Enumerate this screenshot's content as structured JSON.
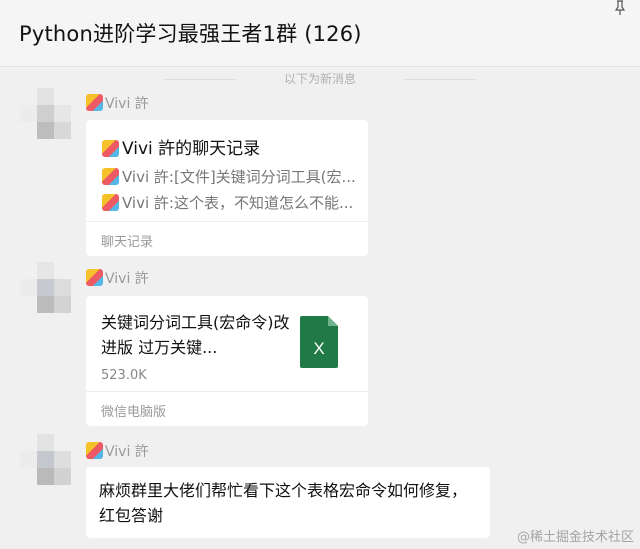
{
  "header": {
    "title": "Python进阶学习最强王者1群 (126)"
  },
  "divider": {
    "text": "以下为新消息"
  },
  "messages": [
    {
      "sender": "Vivi 許",
      "card": {
        "title": "Vivi 許的聊天记录",
        "lines": [
          "Vivi 許:[文件]关键词分词工具(宏...",
          "Vivi 許:这个表，不知道怎么不能..."
        ],
        "footer": "聊天记录"
      }
    },
    {
      "sender": "Vivi 許",
      "file": {
        "name": "关键词分词工具(宏命令)改进版 过万关键...",
        "size": "523.0K",
        "icon_letter": "X",
        "footer": "微信电脑版"
      }
    },
    {
      "sender": "Vivi 許",
      "text": "麻烦群里大佬们帮忙看下这个表格宏命令如何修复，红包答谢"
    }
  ],
  "watermark": "@稀土掘金技术社区",
  "colors": {
    "excel_green": "#1f7a45",
    "background": "#f0f0f0"
  }
}
